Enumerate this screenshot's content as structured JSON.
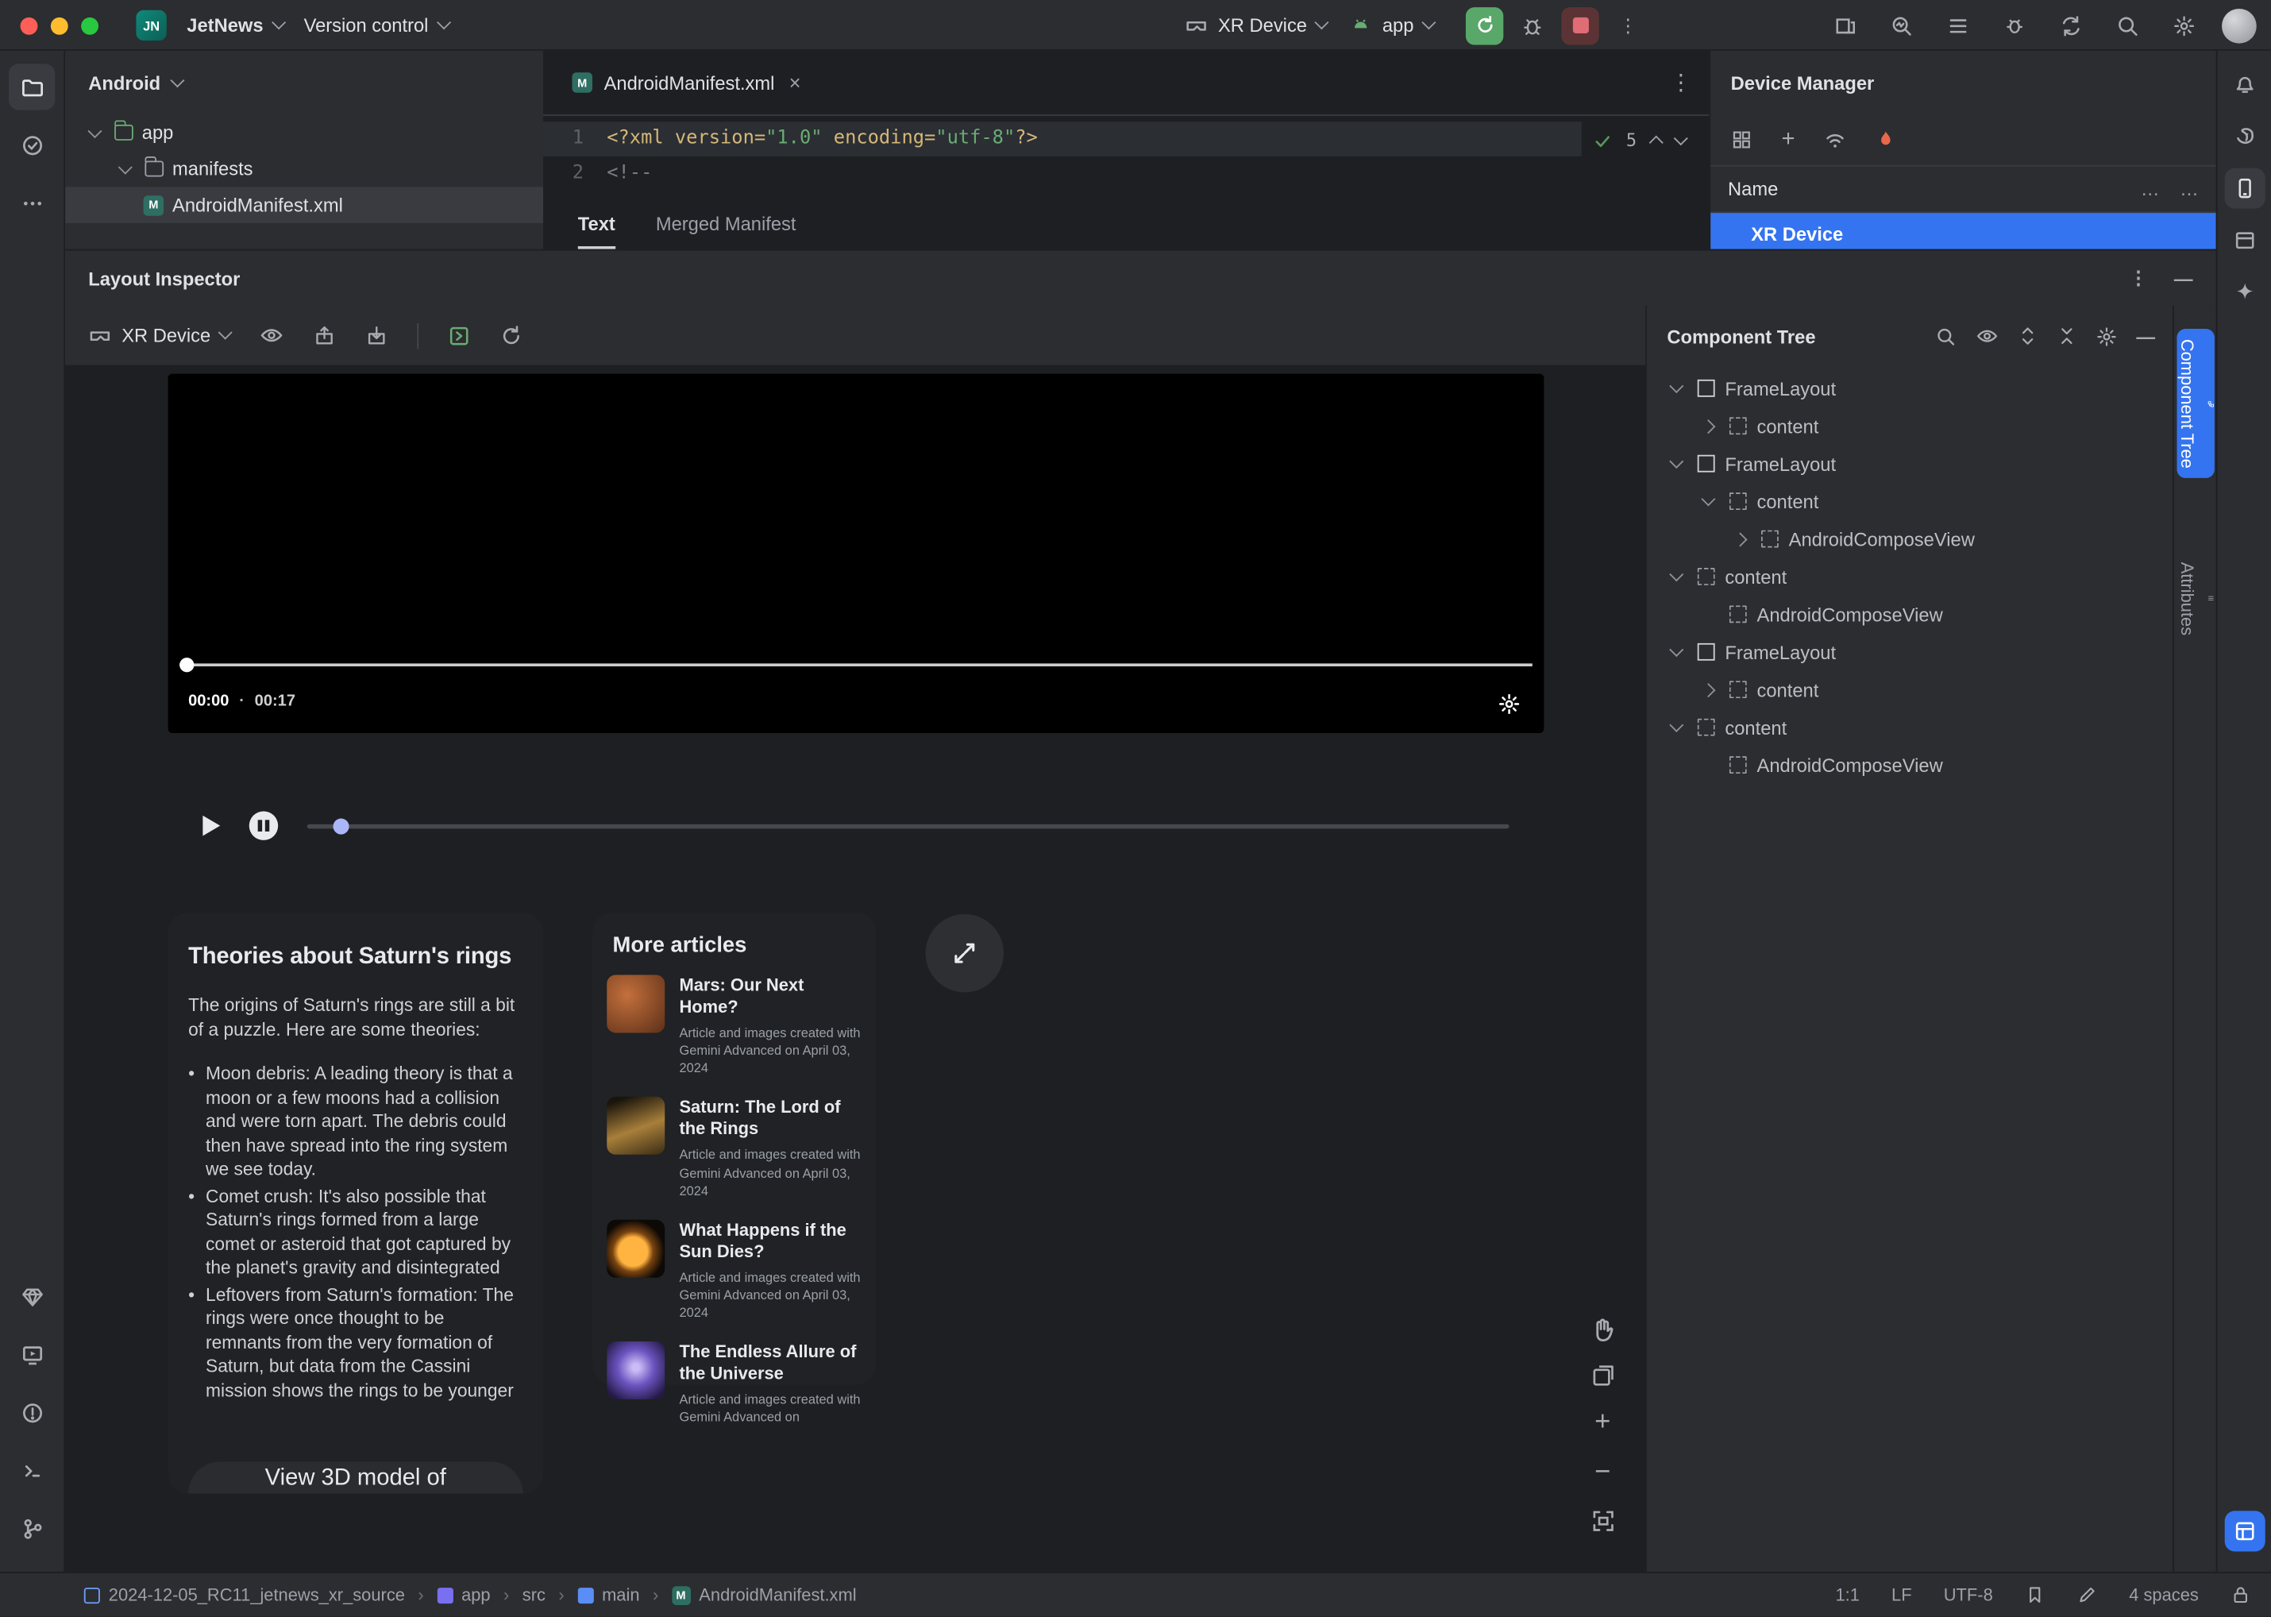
{
  "titlebar": {
    "logo": "JN",
    "project": "JetNews",
    "vcs": "Version control",
    "device": "XR Device",
    "run_config": "app"
  },
  "project": {
    "view": "Android",
    "items": [
      {
        "label": "app"
      },
      {
        "label": "manifests"
      },
      {
        "label": "AndroidManifest.xml"
      }
    ]
  },
  "editor": {
    "tab": "AndroidManifest.xml",
    "close": "×",
    "kebab": "⋮",
    "checks": "5",
    "lines": [
      {
        "num": "1",
        "tokens": [
          {
            "t": "<?xml version="
          },
          {
            "t": "\"1.0\""
          },
          {
            "t": " encoding="
          },
          {
            "t": "\"utf-8\""
          },
          {
            "t": "?>"
          }
        ]
      },
      {
        "num": "2",
        "tokens": [
          {
            "t": "<!--"
          }
        ]
      }
    ],
    "view_tabs": {
      "text": "Text",
      "merged": "Merged Manifest"
    }
  },
  "device_manager": {
    "title": "Device Manager",
    "name_col": "Name",
    "ellipsis": "…",
    "device": "XR Device"
  },
  "inspector": {
    "title": "Layout Inspector",
    "device": "XR Device",
    "kebab": "⋮",
    "minimize": "—",
    "video": {
      "time": "00:00",
      "duration": "00:17"
    },
    "saturn_card": {
      "title": "Theories about Saturn's rings",
      "intro": "The origins of Saturn's rings are still a bit of a puzzle. Here are some theories:",
      "bullets": [
        "Moon debris: A leading theory is that a moon or a few moons had a collision and were torn apart. The debris could then have spread into the ring system we see today.",
        "Comet crush: It's also possible that Saturn's rings formed from a large comet or asteroid that got captured by the planet's gravity and disintegrated",
        "Leftovers from Saturn's formation: The rings were once thought to be remnants from the very formation of Saturn, but data from the Cassini mission shows the rings to be younger"
      ],
      "button": "View 3D model of"
    },
    "articles_card": {
      "title": "More articles",
      "articles": [
        {
          "title": "Mars: Our Next Home?",
          "sub": "Article and images created with Gemini Advanced on April 03, 2024",
          "thumb": "th-mars"
        },
        {
          "title": "Saturn: The Lord of the Rings",
          "sub": "Article and images created with Gemini Advanced on April 03, 2024",
          "thumb": "th-saturn"
        },
        {
          "title": "What Happens if the Sun Dies?",
          "sub": "Article and images created with Gemini Advanced on April 03, 2024",
          "thumb": "th-sun"
        },
        {
          "title": "The Endless Allure of the Universe",
          "sub": "Article and images created with Gemini Advanced on",
          "thumb": "th-galaxy"
        }
      ]
    }
  },
  "component_tree": {
    "title": "Component Tree",
    "nodes": [
      {
        "label": "FrameLayout",
        "ind": "ind0",
        "chev": "chev-down",
        "icon": "ic-frame"
      },
      {
        "label": "content",
        "ind": "ind1",
        "chev": "chev-right",
        "icon": "ic-content"
      },
      {
        "label": "FrameLayout",
        "ind": "ind0",
        "chev": "chev-down",
        "icon": "ic-frame"
      },
      {
        "label": "content",
        "ind": "ind1",
        "chev": "chev-down",
        "icon": "ic-content"
      },
      {
        "label": "AndroidComposeView",
        "ind": "ind2",
        "chev": "chev-right",
        "icon": "ic-content"
      },
      {
        "label": "content",
        "ind": "ind0",
        "chev": "chev-down",
        "icon": "ic-content"
      },
      {
        "label": "AndroidComposeView",
        "ind": "ind1",
        "chev": "chev-none",
        "icon": "ic-content"
      },
      {
        "label": "FrameLayout",
        "ind": "ind0",
        "chev": "chev-down",
        "icon": "ic-frame"
      },
      {
        "label": "content",
        "ind": "ind1",
        "chev": "chev-right",
        "icon": "ic-content"
      },
      {
        "label": "content",
        "ind": "ind0",
        "chev": "chev-down",
        "icon": "ic-content"
      },
      {
        "label": "AndroidComposeView",
        "ind": "ind1",
        "chev": "chev-none",
        "icon": "ic-content"
      }
    ]
  },
  "right_tabs": {
    "component_tree": "Component Tree",
    "attributes": "Attributes"
  },
  "statusbar": {
    "crumbs": [
      {
        "label": "2024-12-05_RC11_jetnews_xr_source",
        "icon": "ci-root"
      },
      {
        "label": "app",
        "icon": "ci-module"
      },
      {
        "label": "src",
        "icon": "ci-none"
      },
      {
        "label": "main",
        "icon": "ci-main"
      },
      {
        "label": "AndroidManifest.xml",
        "icon": "ci-manifest"
      }
    ],
    "cursor": "1:1",
    "line_sep": "LF",
    "encoding": "UTF-8",
    "indent": "4 spaces"
  }
}
